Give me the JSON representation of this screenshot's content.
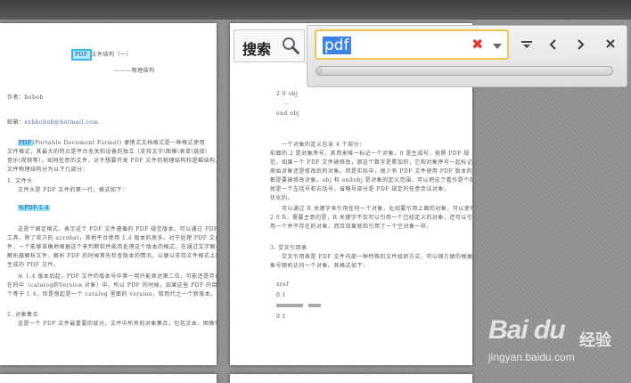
{
  "search": {
    "label": "搜索",
    "query": "pdf",
    "progress_fraction": 0.02
  },
  "watermark": {
    "logo": "Bai du",
    "cn": "经验",
    "url": "jingyan.baidu.com"
  },
  "colors": {
    "find_highlight": "#8fe3f7",
    "input_border": "#f0c653",
    "selection": "#3b84e4",
    "clear": "#e2372b"
  },
  "icons": [
    "search-icon",
    "clear-icon",
    "dropdown-arrow-icon",
    "options-icon",
    "previous-icon",
    "next-icon",
    "close-icon"
  ],
  "page1": {
    "title_term": "PDF",
    "title_rest": "文件结构（一）",
    "subtitle": "———物理结构",
    "author": "作者：hobob",
    "email_label": "邮箱：",
    "email": "xxhbobob@hotmail.com",
    "p1_term": "PDF",
    "p1_a": "(Portable    Document    Format) 便携式文档格式是一种格式使用",
    "p1_b": "文件格式，其最大的特点是平台无关和设备的独立（支持文字\\图像\\表单\\链接\\",
    "p1_c": "音乐\\视频等）。如同任意的文件，对于想要开发 PDF 文件的物理结构和逻辑结构，PDF",
    "p1_d": "文件物理结构分为以下几部分：",
    "h1": "1. 文件头",
    "h1_a": "文件头是 PDF 文件的第一行，格式如下：",
    "h1_code": "%PDF-1.4",
    "p2_a": "这是个固定格式，表示这个 PDF 文件遵循的 PDF 规范版本。可以通过 PDF 的生成",
    "p2_b": "工具，除了官方的 acrobat，其他平台使用 1.4 版本的居多。对于处理 PDF 文件的软",
    "p2_c": "件，一个能够准确地根据这个来判断软件能否处理这个版本的格式。在通过文字解析的",
    "p2_d": "解析器解析文件，解析 PDF 的时候首先检查版本的情况。以便以支持文件格式上面",
    "p2_e": "生成的 PDF 文件。",
    "p3_a": "从 1.4 版本后起，PDF 文件的版本号中第一项只能表达第二位，可能还是存在",
    "p3_b": "在的中（catalog的Version 对象）中。所以 PDF 的时候，如果这些 PDF 的目录",
    "p3_c": "个等于 1.4，但是想起是一个 catalog 里面的 version，取而代之一个新版本。",
    "h2": "2. 对象集合",
    "h2_a": "这是一个 PDF 文件最重要的部分，文件中所有的对象集合，包括文本、图像等"
  },
  "page2": {
    "code1": "2 0 obj",
    "code2": "...",
    "code3": "end obj",
    "p1_a": "一个对象的定义包含 4 个部分：",
    "p1_b": "前面的 2 是对象序号，其用来唯一标记一个对象。0 是生成号，按照 PDF 规",
    "p1_c": "范，如果一个 PDF 文件被修改，那这个数字是累加的，它和对象序号一起标记是",
    "p1_d": "原始对象还是修改后的对象。但是实际中，很少有 PDF 文件使用 PDF 版本的。",
    "p1_e": "都是要被修改对象。obj 和 endobj 是对象的定义范围，可以把这个看作是个前后括号。",
    "p1_f": "就是一个左括号和右括号，省略号部分是 PDF 规定的任意合法对象。",
    "p1_g": "优化的。",
    "p2_a": "可以通过 R 关键字来引用任何一个对象，比如要引用上面的对象，可以使用",
    "p2_b": "2 0 R，需要主意的是，R 关键字不仅可以引用一个已经定义的对象，还可以引用",
    "p2_c": "用一个并不存在的对象，而且效果就和引用了一个空对象一样。",
    "h3": "3. 交叉引用表",
    "h3_a": "交叉引用表是 PDF 文件内部一种特殊的文件组织方式，可以很方便的根据对",
    "h3_b": "象号随机访问一个对象。其格式如下：",
    "code4": "xref",
    "code5": "0 1",
    "code6": "0 1"
  }
}
